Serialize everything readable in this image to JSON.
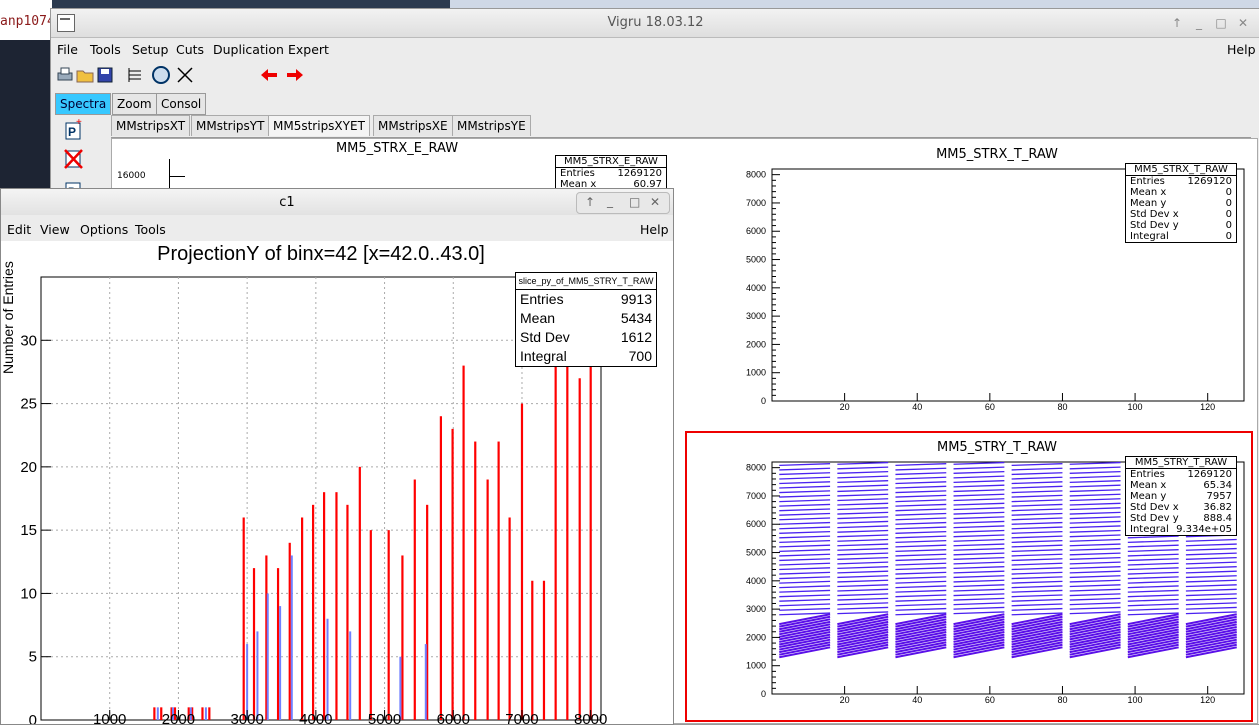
{
  "background": {
    "terminal_text": "anp1074"
  },
  "window": {
    "title": "Vigru  18.03.12",
    "menus": [
      "File",
      "Tools",
      "Setup",
      "Cuts",
      "Duplication",
      "Expert"
    ],
    "help": "Help",
    "subtabs": [
      "Spectra",
      "Zoom",
      "Consol"
    ],
    "tabs": [
      "MMstripsXT",
      "MMstripsYT",
      "MM5stripsXYET",
      "MMstripsXE",
      "MMstripsYE"
    ],
    "active_tab": "MM5stripsXYET"
  },
  "pads": {
    "e_raw": {
      "title": "MM5_STRX_E_RAW",
      "stats_title": "MM5_STRX_E_RAW",
      "stats": [
        [
          "Entries",
          "1269120"
        ],
        [
          "Mean x",
          "60.97"
        ]
      ],
      "y_tick": "16000"
    },
    "strx_t": {
      "title": "MM5_STRX_T_RAW",
      "stats_title": "MM5_STRX_T_RAW",
      "stats": [
        [
          "Entries",
          "1269120"
        ],
        [
          "Mean x",
          "0"
        ],
        [
          "Mean y",
          "0"
        ],
        [
          "Std Dev x",
          "0"
        ],
        [
          "Std Dev y",
          "0"
        ],
        [
          "Integral",
          "0"
        ]
      ],
      "y_ticks": [
        "0",
        "1000",
        "2000",
        "3000",
        "4000",
        "5000",
        "6000",
        "7000",
        "8000"
      ],
      "x_ticks": [
        "20",
        "40",
        "60",
        "80",
        "100",
        "120"
      ]
    },
    "stry_t": {
      "title": "MM5_STRY_T_RAW",
      "stats_title": "MM5_STRY_T_RAW",
      "stats": [
        [
          "Entries",
          "1269120"
        ],
        [
          "Mean x",
          "65.34"
        ],
        [
          "Mean y",
          "7957"
        ],
        [
          "Std Dev x",
          "36.82"
        ],
        [
          "Std Dev y",
          "888.4"
        ],
        [
          "Integral",
          "9.334e+05"
        ]
      ],
      "y_ticks": [
        "0",
        "1000",
        "2000",
        "3000",
        "4000",
        "5000",
        "6000",
        "7000",
        "8000"
      ],
      "x_ticks": [
        "20",
        "40",
        "60",
        "80",
        "100",
        "120"
      ]
    }
  },
  "c1": {
    "title": "c1",
    "menus": [
      "Edit",
      "View",
      "Options",
      "Tools"
    ],
    "help": "Help",
    "stats_title": "slice_py_of_MM5_STRY_T_RAW",
    "stats": [
      [
        "Entries",
        "9913"
      ],
      [
        "Mean",
        "5434"
      ],
      [
        "Std Dev",
        "1612"
      ],
      [
        "Integral",
        "700"
      ]
    ],
    "y_axis_label": "Number of Entries"
  },
  "chart_data": {
    "type": "bar",
    "title": "ProjectionY of binx=42 [x=42.0..43.0]",
    "xlabel": "",
    "ylabel": "Number of Entries",
    "xlim": [
      0,
      8150
    ],
    "ylim": [
      0,
      35
    ],
    "x_ticks": [
      1000,
      2000,
      3000,
      4000,
      5000,
      6000,
      7000,
      8000
    ],
    "y_ticks": [
      0,
      5,
      10,
      15,
      20,
      25,
      30
    ],
    "grid": true,
    "series": [
      {
        "name": "",
        "color": "#ff0000",
        "x": [
          1650,
          1750,
          1900,
          1950,
          2150,
          2200,
          2350,
          2450,
          2950,
          3100,
          3280,
          3450,
          3620,
          3800,
          3960,
          4120,
          4300,
          4460,
          4640,
          4800,
          5060,
          5260,
          5440,
          5620,
          5820,
          5990,
          6150,
          6320,
          6500,
          6660,
          6820,
          7000,
          7150,
          7320,
          7490,
          7660,
          7840,
          8000
        ],
        "values": [
          1,
          1,
          1,
          1,
          1,
          1,
          1,
          1,
          16,
          12,
          13,
          12,
          14,
          16,
          17,
          18,
          18,
          17,
          20,
          15,
          15,
          13,
          19,
          17,
          24,
          23,
          28,
          22,
          19,
          22,
          16,
          25,
          11,
          11,
          28,
          29,
          27,
          35
        ]
      },
      {
        "name": "",
        "color": "#7080ff",
        "x": [
          1700,
          1920,
          2180,
          2400,
          3000,
          3150,
          3300,
          3480,
          3650,
          4170,
          4500,
          5230,
          5600
        ],
        "values": [
          1,
          1,
          1,
          1,
          6,
          7,
          10,
          9,
          13,
          8,
          7,
          5,
          6
        ]
      }
    ]
  }
}
